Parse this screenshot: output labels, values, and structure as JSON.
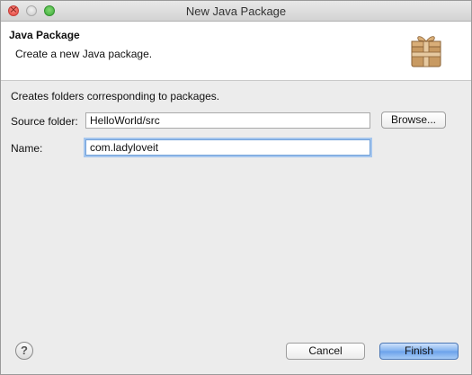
{
  "window": {
    "title": "New Java Package"
  },
  "banner": {
    "title": "Java Package",
    "message": "Create a new Java package.",
    "icon": "package-icon"
  },
  "form": {
    "description": "Creates folders corresponding to packages.",
    "source_folder": {
      "label": "Source folder:",
      "value": "HelloWorld/src",
      "browse_label": "Browse..."
    },
    "name": {
      "label": "Name:",
      "value": "com.ladyloveit"
    }
  },
  "footer": {
    "help_icon": "help-icon",
    "help_glyph": "?",
    "cancel_label": "Cancel",
    "finish_label": "Finish"
  },
  "colors": {
    "accent": "#6aa1ea",
    "focus_ring": "#a5c6ee"
  }
}
